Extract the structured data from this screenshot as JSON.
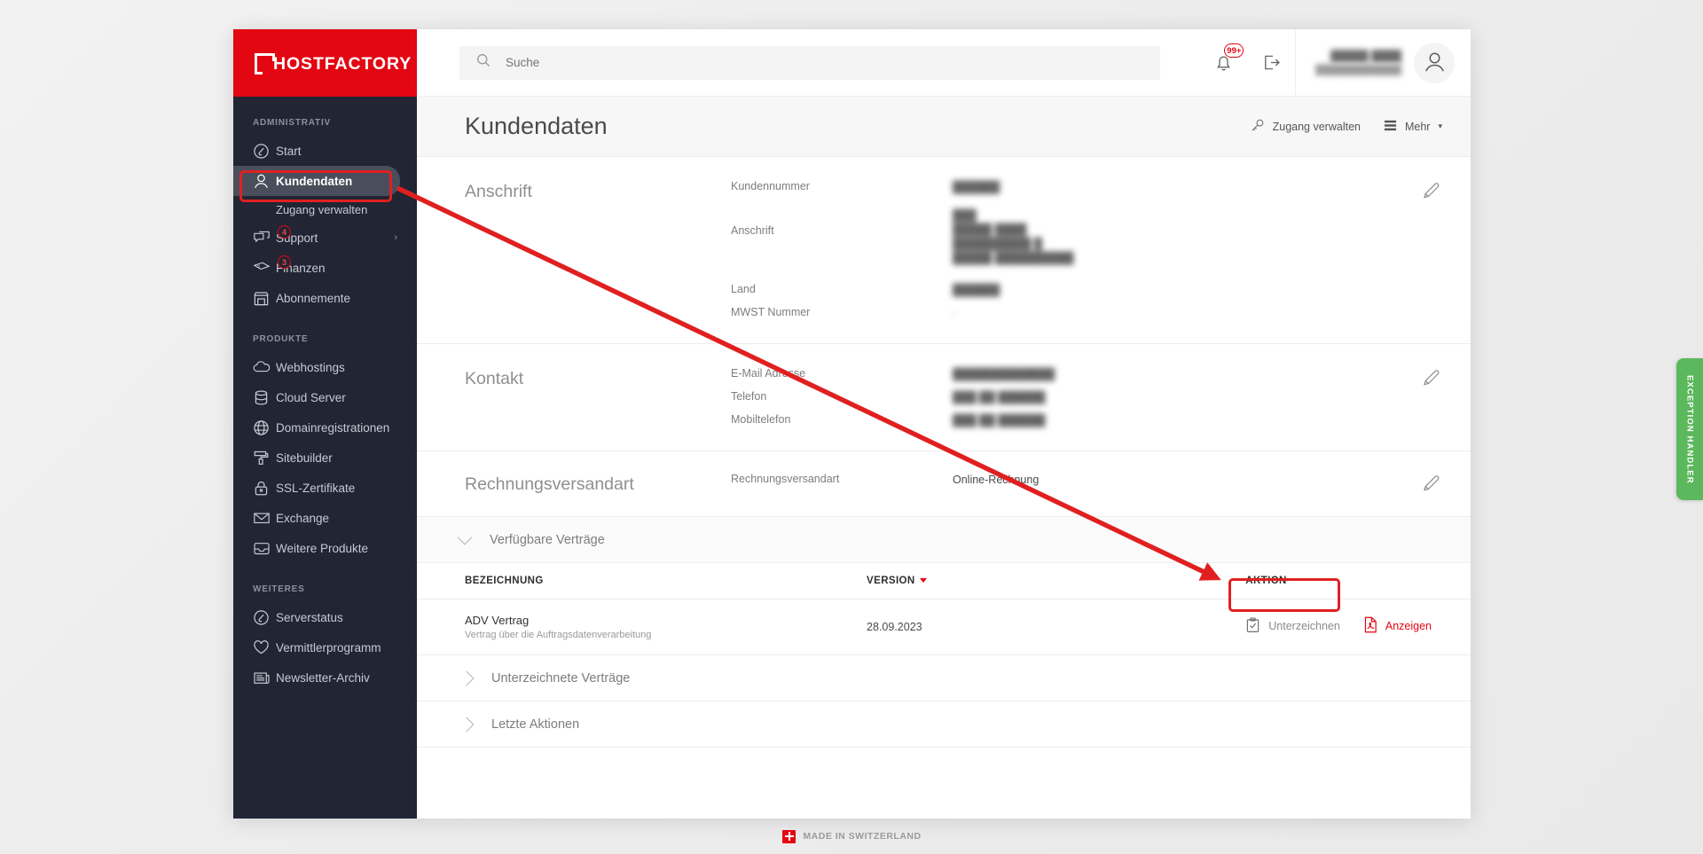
{
  "brand": {
    "name": "HOSTFACTORY",
    "color": "#e30613"
  },
  "sidebar": {
    "sections": [
      {
        "label": "ADMINISTRATIV",
        "items": [
          {
            "label": "Start",
            "icon": "gauge-icon",
            "active": false
          },
          {
            "label": "Kundendaten",
            "icon": "user-icon",
            "active": true,
            "subitems": [
              {
                "label": "Zugang verwalten"
              }
            ]
          },
          {
            "label": "Support",
            "icon": "chat-icon",
            "badge": "4",
            "chevron": "›"
          },
          {
            "label": "Finanzen",
            "icon": "money-icon",
            "badge": "3"
          },
          {
            "label": "Abonnemente",
            "icon": "shop-icon"
          }
        ]
      },
      {
        "label": "PRODUKTE",
        "items": [
          {
            "label": "Webhostings",
            "icon": "cloud-icon"
          },
          {
            "label": "Cloud Server",
            "icon": "database-icon"
          },
          {
            "label": "Domainregistrationen",
            "icon": "globe-icon"
          },
          {
            "label": "Sitebuilder",
            "icon": "paint-roller-icon"
          },
          {
            "label": "SSL-Zertifikate",
            "icon": "lock-icon"
          },
          {
            "label": "Exchange",
            "icon": "envelope-icon"
          },
          {
            "label": "Weitere Produkte",
            "icon": "inbox-icon"
          }
        ]
      },
      {
        "label": "WEITERES",
        "items": [
          {
            "label": "Serverstatus",
            "icon": "gauge-icon"
          },
          {
            "label": "Vermittlerprogramm",
            "icon": "heart-icon"
          },
          {
            "label": "Newsletter-Archiv",
            "icon": "newspaper-icon"
          }
        ]
      }
    ]
  },
  "topbar": {
    "search_placeholder": "Suche",
    "search_value": "",
    "notification_badge": "99+",
    "user_name": "█████ ████",
    "user_email": "█████████████"
  },
  "page": {
    "title": "Kundendaten",
    "actions": [
      {
        "label": "Zugang verwalten",
        "icon": "key-icon"
      },
      {
        "label": "Mehr",
        "icon": "list-icon",
        "caret": "▾"
      }
    ]
  },
  "sections": [
    {
      "title": "Anschrift",
      "fields": [
        {
          "label": "Kundennummer",
          "value": "██████",
          "blurred": true
        },
        {
          "label": "Anschrift",
          "value": "███\n█████ ████\n██████████ █\n█████ ██████████",
          "blurred": true
        },
        {
          "label": "Land",
          "value": "██████",
          "blurred": true
        },
        {
          "label": "MWST Nummer",
          "value": "-",
          "blurred": true
        }
      ]
    },
    {
      "title": "Kontakt",
      "fields": [
        {
          "label": "E-Mail Adresse",
          "value": "█████████████",
          "blurred": true
        },
        {
          "label": "Telefon",
          "value": "███ ██ ██████",
          "blurred": true
        },
        {
          "label": "Mobiltelefon",
          "value": "███ ██ ██████",
          "blurred": true
        }
      ]
    },
    {
      "title": "Rechnungsversandart",
      "fields": [
        {
          "label": "Rechnungsversandart",
          "value": "Online-Rechnung",
          "blurred": false
        }
      ]
    }
  ],
  "accordions": {
    "available_contracts": {
      "label": "Verfügbare Verträge",
      "expanded": true
    },
    "signed_contracts": {
      "label": "Unterzeichnete Verträge",
      "expanded": false
    },
    "last_actions": {
      "label": "Letzte Aktionen",
      "expanded": false
    }
  },
  "contracts_table": {
    "headers": {
      "name": "BEZEICHNUNG",
      "version": "VERSION",
      "action": "AKTION"
    },
    "sorted_by": "VERSION",
    "rows": [
      {
        "name": "ADV Vertrag",
        "description": "Vertrag über die Auftragsdatenverarbeitung",
        "version": "28.09.2023",
        "actions": [
          {
            "label": "Unterzeichnen",
            "icon": "clipboard-check-icon",
            "style": "gray"
          },
          {
            "label": "Anzeigen",
            "icon": "pdf-icon",
            "style": "red"
          }
        ]
      }
    ]
  },
  "footer": {
    "text": "MADE IN SWITZERLAND",
    "icon": "swiss-flag-icon"
  },
  "exception_tab": {
    "label": "EXCEPTION HANDLER",
    "color": "#5cb85c"
  },
  "annotations": {
    "highlight_nav": "Kundendaten",
    "highlight_button": "Unterzeichnen",
    "arrow_color": "#e02020"
  }
}
